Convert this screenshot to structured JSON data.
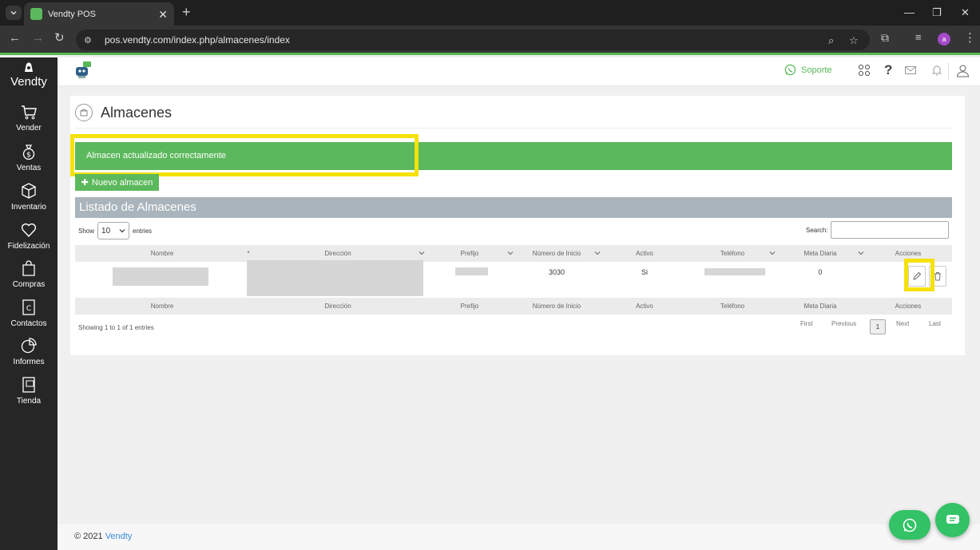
{
  "browser": {
    "tab_title": "Vendty POS",
    "url": "pos.vendty.com/index.php/almacenes/index",
    "profile_initial": "a"
  },
  "sidebar": {
    "brand": "Vendty",
    "items": [
      {
        "label": "Vender",
        "icon": "cart-icon"
      },
      {
        "label": "Ventas",
        "icon": "money-bag-icon"
      },
      {
        "label": "Inventario",
        "icon": "box-icon"
      },
      {
        "label": "Fidelización",
        "icon": "heart-icon"
      },
      {
        "label": "Compras",
        "icon": "shopping-bag-icon"
      },
      {
        "label": "Contactos",
        "icon": "contacts-icon"
      },
      {
        "label": "Informes",
        "icon": "pie-chart-icon"
      },
      {
        "label": "Tienda",
        "icon": "store-icon"
      }
    ]
  },
  "header": {
    "support_label": "Soporte"
  },
  "page": {
    "title": "Almacenes",
    "alert": "Almacen actualizado correctamente",
    "new_button": "Nuevo almacen",
    "list_title": "Listado de Almacenes",
    "show_label": "Show",
    "entries_value": "10",
    "entries_label": "entries",
    "search_label": "Search:",
    "search_value": ""
  },
  "table": {
    "columns": [
      "Nombre",
      "Dirección",
      "Prefijo",
      "Número de Inicio",
      "Activo",
      "Teléfono",
      "Meta Diaria",
      "Acciones"
    ],
    "sort_marker": "*",
    "rows": [
      {
        "nombre": "",
        "direccion": "",
        "prefijo": "",
        "numero_inicio": "3030",
        "activo": "Si",
        "telefono": "",
        "meta_diaria": "0"
      }
    ],
    "info": "Showing 1 to 1 of 1 entries",
    "pagination": {
      "first": "First",
      "previous": "Previous",
      "current": "1",
      "next": "Next",
      "last": "Last"
    }
  },
  "footer": {
    "copyright": "© 2021",
    "link": "Vendty"
  },
  "colors": {
    "brand_green": "#5cb85c",
    "highlight": "#f5e10b",
    "sidebar": "#262626",
    "list_header": "#a9b4bc"
  }
}
